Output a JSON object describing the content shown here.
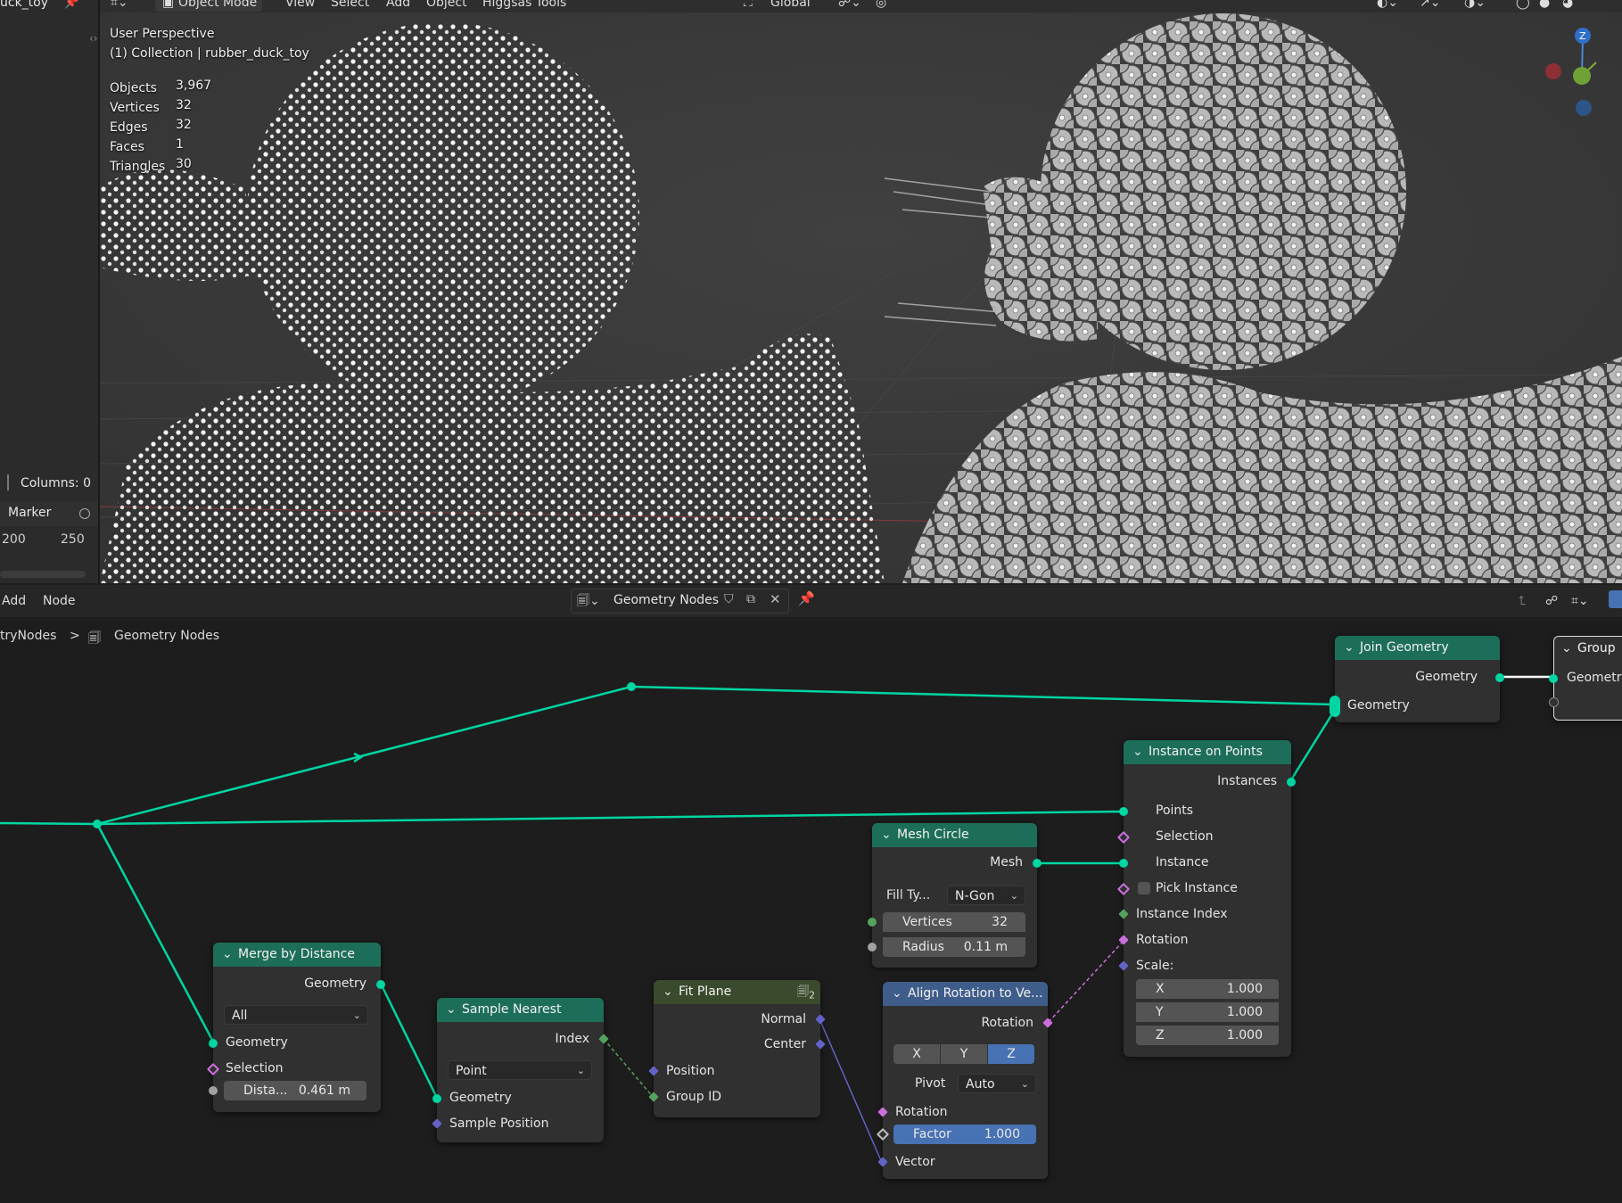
{
  "window": {
    "object_name_clipped": "uck_toy"
  },
  "viewport_header": {
    "mode": "Object Mode",
    "menus": [
      "View",
      "Select",
      "Add",
      "Object",
      "Higgsas Tools"
    ],
    "transform_orientation": "Global"
  },
  "viewport": {
    "perspective": "User Perspective",
    "collection_line": "(1) Collection | rubber_duck_toy",
    "stats": [
      {
        "label": "Objects",
        "value": "3,967"
      },
      {
        "label": "Vertices",
        "value": "32"
      },
      {
        "label": "Edges",
        "value": "32"
      },
      {
        "label": "Faces",
        "value": "1"
      },
      {
        "label": "Triangles",
        "value": "30"
      }
    ],
    "gizmo_axis_label": "Z"
  },
  "left_panel": {
    "columns_label": "Columns: 0",
    "marker_label": "Marker",
    "timeline_ticks": [
      "200",
      "250"
    ]
  },
  "node_editor_header": {
    "menus": [
      "Add",
      "Node"
    ],
    "node_tree_name": "Geometry Nodes"
  },
  "breadcrumb": {
    "parent": "tryNodes",
    "separator": ">",
    "current": "Geometry Nodes"
  },
  "nodes": {
    "join_geometry": {
      "title": "Join Geometry",
      "output": "Geometry",
      "input": "Geometry"
    },
    "group_output": {
      "title": "Group",
      "input": "Geometry"
    },
    "instance_on_points": {
      "title": "Instance on Points",
      "output": "Instances",
      "inputs": [
        "Points",
        "Selection",
        "Instance",
        "Pick Instance",
        "Instance Index",
        "Rotation",
        "Scale:"
      ],
      "scale": [
        {
          "axis": "X",
          "value": "1.000"
        },
        {
          "axis": "Y",
          "value": "1.000"
        },
        {
          "axis": "Z",
          "value": "1.000"
        }
      ]
    },
    "mesh_circle": {
      "title": "Mesh Circle",
      "output": "Mesh",
      "fill_type_label": "Fill Ty...",
      "fill_type_value": "N-Gon",
      "vertices_label": "Vertices",
      "vertices_value": "32",
      "radius_label": "Radius",
      "radius_value": "0.11 m"
    },
    "merge_by_distance": {
      "title": "Merge by Distance",
      "output": "Geometry",
      "mode": "All",
      "inputs": [
        "Geometry",
        "Selection"
      ],
      "distance_label": "Dista...",
      "distance_value": "0.461 m"
    },
    "sample_nearest": {
      "title": "Sample Nearest",
      "output": "Index",
      "domain": "Point",
      "inputs": [
        "Geometry",
        "Sample Position"
      ]
    },
    "fit_plane": {
      "title": "Fit Plane",
      "badge": "2",
      "outputs": [
        "Normal",
        "Center"
      ],
      "inputs": [
        "Position",
        "Group ID"
      ]
    },
    "align_rotation": {
      "title": "Align Rotation to Ve...",
      "output": "Rotation",
      "axes": [
        "X",
        "Y",
        "Z"
      ],
      "active_axis": "Z",
      "pivot_label": "Pivot",
      "pivot_value": "Auto",
      "inputs": [
        "Rotation",
        "Vector"
      ],
      "factor_label": "Factor",
      "factor_value": "1.000"
    }
  },
  "colors": {
    "geometry_socket": "#00d6a3",
    "node_header_geometry": "#1d6e58",
    "node_header_vector": "#3f5d8b",
    "rotation_socket": "#cc6fdc",
    "vector_socket": "#6363c7",
    "integer_socket": "#55a25d",
    "active_button": "#4772b3"
  }
}
